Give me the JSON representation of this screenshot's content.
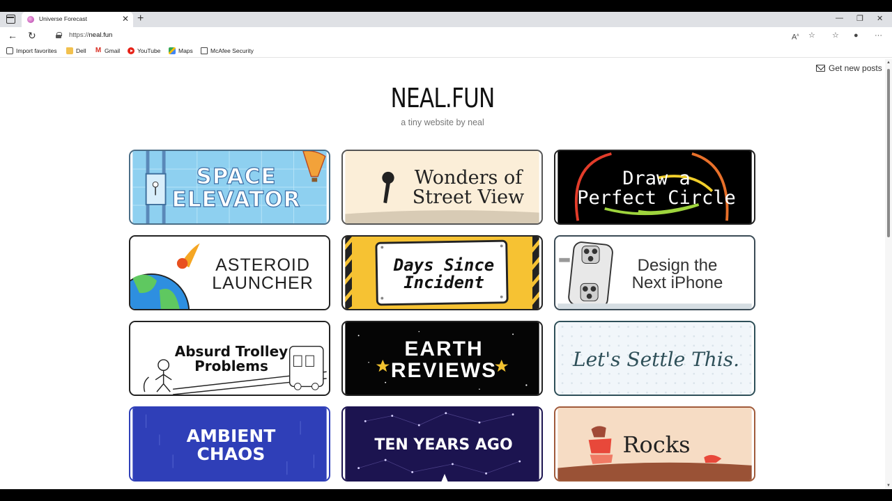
{
  "browser": {
    "tab_title": "Universe Forecast",
    "url_scheme": "https://",
    "url_host": "neal.fun"
  },
  "favorites": [
    {
      "label": "Import favorites",
      "icon": "import-icon"
    },
    {
      "label": "Dell",
      "icon": "folder-icon"
    },
    {
      "label": "Gmail",
      "icon": "gmail-icon"
    },
    {
      "label": "YouTube",
      "icon": "youtube-icon"
    },
    {
      "label": "Maps",
      "icon": "maps-icon"
    },
    {
      "label": "McAfee Security",
      "icon": "document-icon"
    }
  ],
  "header": {
    "get_posts": "Get new posts",
    "title": "NEAL.FUN",
    "subtitle": "a tiny website by neal"
  },
  "tiles": [
    {
      "label": "SPACE\nELEVATOR",
      "bg": "#8ed0f0"
    },
    {
      "label": "Wonders of\nStreet View",
      "bg": "#fbeed8"
    },
    {
      "label": "Draw a\nPerfect Circle",
      "bg": "#000000"
    },
    {
      "label": "ASTEROID\nLAUNCHER",
      "bg": "#ffffff"
    },
    {
      "label": "Days Since\nIncident",
      "bg": "#f6c233"
    },
    {
      "label": "Design the\nNext iPhone",
      "bg": "#ffffff"
    },
    {
      "label": "Absurd Trolley\nProblems",
      "bg": "#ffffff"
    },
    {
      "label": "EARTH\nREVIEWS",
      "bg": "#050505"
    },
    {
      "label": "Let's Settle This.",
      "bg": "#f1f6fa"
    },
    {
      "label": "AMBIENT\nCHAOS",
      "bg": "#2f3fb8"
    },
    {
      "label": "TEN YEARS AGO",
      "bg": "#1c1450"
    },
    {
      "label": "Rocks",
      "bg": "#f6dcc4"
    }
  ]
}
